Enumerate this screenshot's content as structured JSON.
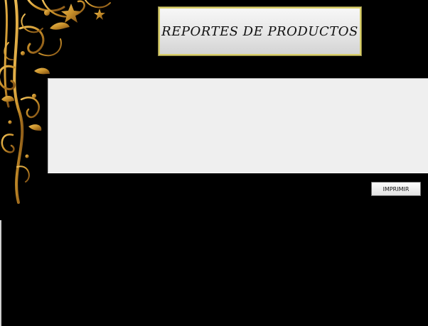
{
  "header": {
    "title": "REPORTES DE PRODUCTOS"
  },
  "report": {
    "content": ""
  },
  "actions": {
    "print_label": "IMPRIMIR"
  },
  "decor": {
    "ornament_icon": "golden-floral-ornament-icon",
    "ornament_color": "#c8902a"
  }
}
